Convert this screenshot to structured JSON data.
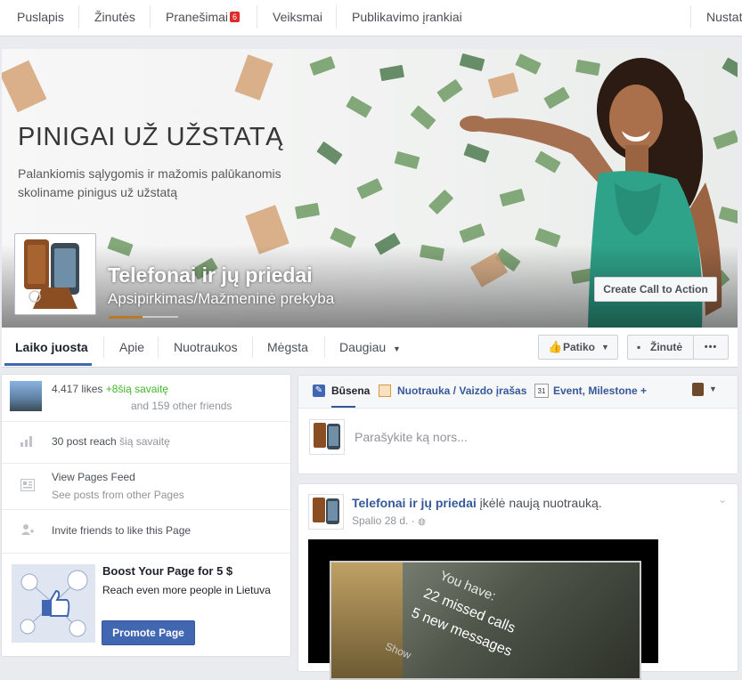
{
  "topnav": {
    "items": [
      "Puslapis",
      "Žinutės",
      "Pranešimai",
      "Veiksmai",
      "Publikavimo įrankiai",
      "Nustat"
    ],
    "notifications_badge": "6"
  },
  "cover": {
    "title": "PINIGAI UŽ UŽSTATĄ",
    "subtitle_line1": "Palankiomis sąlygomis ir mažomis palūkanomis",
    "subtitle_line2": "skoliname pinigus už užstatą"
  },
  "page": {
    "name": "Telefonai ir jų priedai",
    "category": "Apsipirkimas/Mažmeninė prekyba",
    "cta_label": "Create Call to Action"
  },
  "tabs": {
    "items": [
      "Laiko juosta",
      "Apie",
      "Nuotraukos",
      "Mėgsta",
      "Daugiau"
    ],
    "like_label": "Patiko",
    "message_label": "Žinutė",
    "more_label": "•••"
  },
  "sidebar": {
    "likes": "4.417 likes",
    "likes_week": "+8šią savaitę",
    "friends": "and 159 other friends",
    "reach": "30 post reach",
    "reach_week": "šią savaitę",
    "feed_title": "View Pages Feed",
    "feed_sub": "See posts from other Pages",
    "invite": "Invite friends to like this Page",
    "boost_title": "Boost Your Page for 5 $",
    "boost_sub": "Reach even more people in Lietuva",
    "promote_label": "Promote Page"
  },
  "composer": {
    "tab_status": "Būsena",
    "tab_photo": "Nuotrauka / Vaizdo įrašas",
    "tab_event": "Event, Milestone +",
    "calendar_day": "31",
    "placeholder": "Parašykite ką nors..."
  },
  "post": {
    "author": "Telefonai ir jų priedai",
    "action": "įkėlė naują nuotrauką.",
    "date": "Spalio 28 d. ·",
    "image_lines": [
      "You have:",
      "22 missed calls",
      "5 new messages",
      "Show"
    ]
  },
  "colors": {
    "brand": "#4267b2",
    "link": "#365899",
    "accent_green": "#42b72a"
  }
}
